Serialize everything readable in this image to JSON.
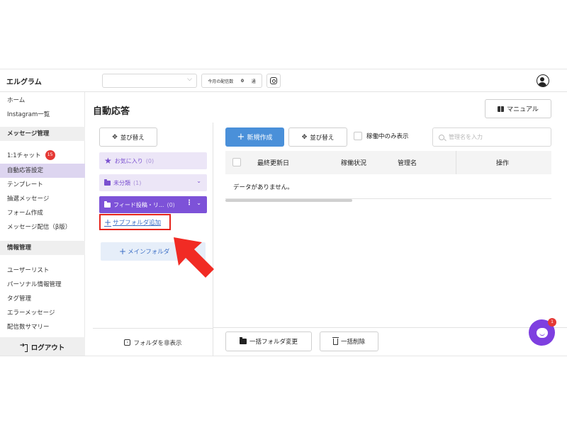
{
  "header": {
    "logo": "エルグラム",
    "delivery_label": "今月の配信数",
    "delivery_count": "0",
    "delivery_unit": "通"
  },
  "sidebar": {
    "items_top": [
      {
        "label": "ホーム"
      },
      {
        "label": "Instagram一覧"
      }
    ],
    "section_message": "メッセージ管理",
    "message_items": [
      {
        "label": "1:1チャット",
        "badge": "15"
      },
      {
        "label": "自動応答設定"
      },
      {
        "label": "テンプレート"
      },
      {
        "label": "抽選メッセージ"
      },
      {
        "label": "フォーム作成"
      },
      {
        "label": "メッセージ配信（β版）"
      }
    ],
    "section_info": "情報管理",
    "info_items": [
      {
        "label": "ユーザーリスト"
      },
      {
        "label": "パーソナル情報管理"
      },
      {
        "label": "タグ管理"
      },
      {
        "label": "エラーメッセージ"
      },
      {
        "label": "配信数サマリー"
      }
    ],
    "logout": "ログアウト"
  },
  "page": {
    "title": "自動応答",
    "manual": "マニュアル"
  },
  "folders": {
    "sort": "並び替え",
    "items": [
      {
        "label": "お気に入り",
        "count": "(0)"
      },
      {
        "label": "未分類",
        "count": "(1)"
      },
      {
        "label": "フィード投稿・リ...",
        "count": "(0)"
      }
    ],
    "add_subfolder": "サブフォルダ追加",
    "add_main_folder": "メインフォルダ",
    "hide": "フォルダを非表示"
  },
  "toolbar": {
    "new": "新規作成",
    "sort": "並び替え",
    "active_only": "稼働中のみ表示",
    "search_placeholder": "管理名を入力"
  },
  "table": {
    "columns": [
      "最終更新日",
      "稼働状況",
      "管理名",
      "操作"
    ],
    "empty": "データがありません。"
  },
  "footer": {
    "bulk_folder": "一括フォルダ変更",
    "bulk_delete": "一括削除"
  },
  "chat": {
    "badge": "1"
  },
  "colors": {
    "accent_purple": "#7d52d8",
    "primary_blue": "#4a90d9",
    "highlight_red": "#e5241d"
  }
}
